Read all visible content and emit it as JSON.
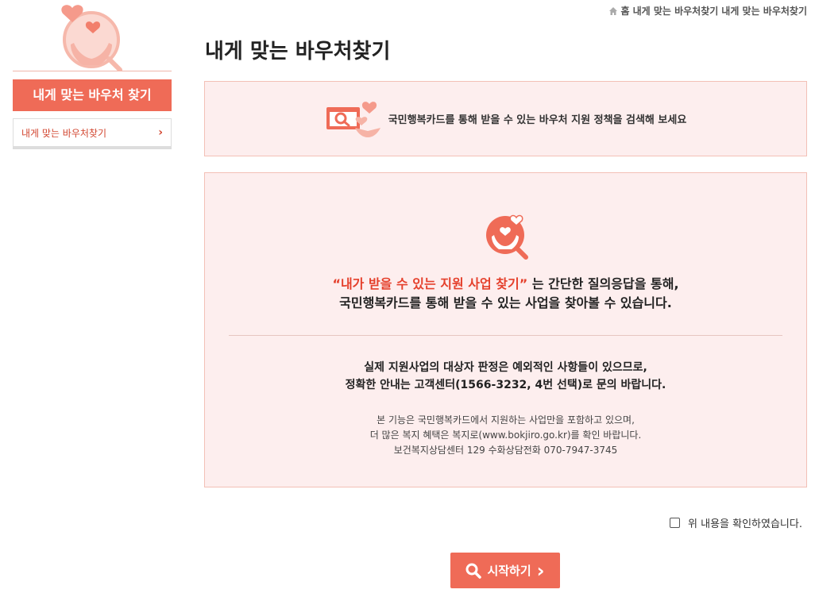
{
  "sidebar": {
    "title": "내게 맞는 바우처 찾기",
    "menu_item": "내게 맞는 바우처찾기",
    "chevron": "›"
  },
  "breadcrumb": {
    "home": "홈",
    "level1": "내게 맞는 바우처찾기",
    "level2": "내게 맞는 바우처찾기"
  },
  "page_title": "내게 맞는 바우처찾기",
  "notice": {
    "text": "국민행복카드를 통해 받을 수 있는 바우처 지원 정책을 검색해 보세요"
  },
  "info": {
    "lead_highlight": "“내가 받을 수 있는 지원 사업 찾기”",
    "lead_rest": " 는 간단한 질의응답을 통해,",
    "lead_line2": "국민행복카드를 통해 받을 수 있는 사업을 찾아볼 수 있습니다.",
    "note1_line1": "실제 지원사업의 대상자 판정은 예외적인 사항들이 있으므로,",
    "note1_line2": "정확한 안내는 고객센터(1566-3232, 4번 선택)로 문의 바랍니다.",
    "note2_line1": "본 기능은 국민행복카드에서 지원하는 사업만을 포함하고 있으며,",
    "note2_line2": "더 많은 복지 혜택은 복지로(www.bokjiro.go.kr)를 확인 바랍니다.",
    "note2_line3": "보건복지상담센터 129 수화상담전화 070-7947-3745"
  },
  "confirm": {
    "label": "위 내용을 확인하였습니다.",
    "checked": false
  },
  "start_button": {
    "label": "시작하기",
    "chevron": "›"
  },
  "colors": {
    "accent": "#ef6b57",
    "highlight": "#e5402c",
    "box_bg": "#fdeeee",
    "box_border": "#f3c0b6"
  },
  "icons": [
    "heart-hands-search-icon",
    "home-icon",
    "search-icon",
    "chevron-right-icon",
    "search-card-icon"
  ]
}
